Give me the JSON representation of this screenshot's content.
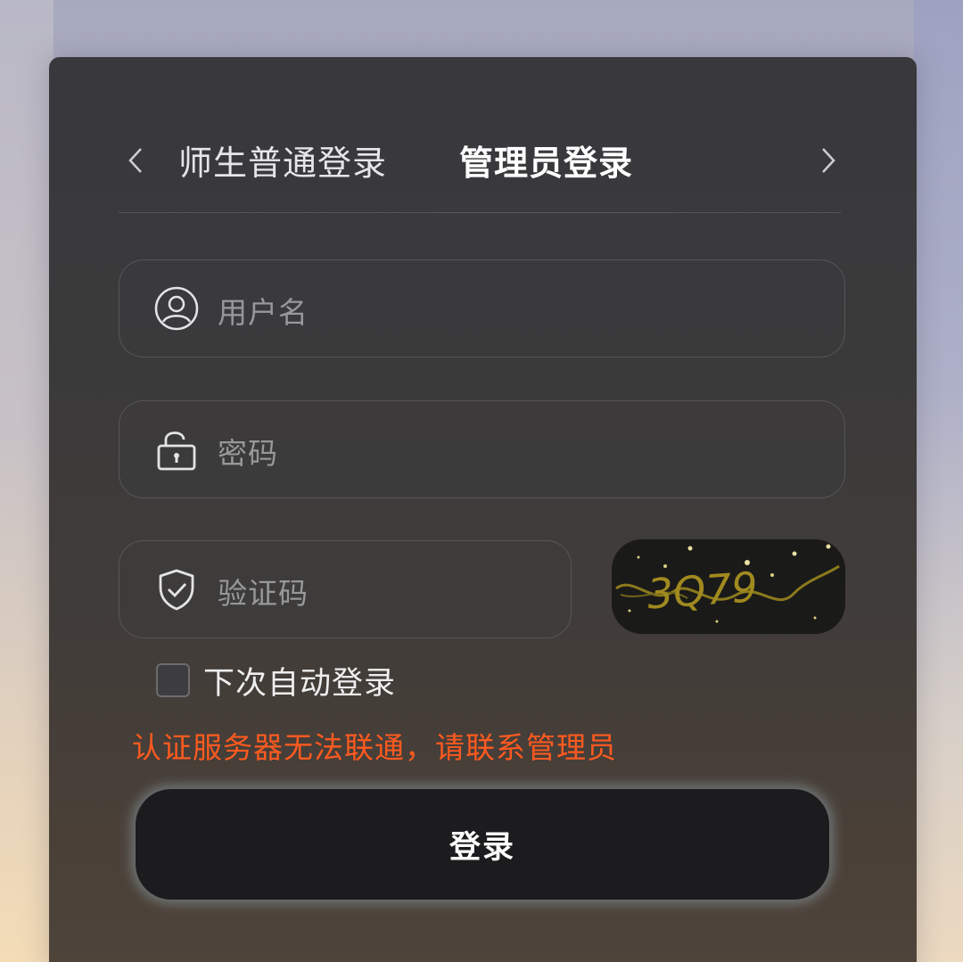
{
  "tabs": {
    "prev_icon": "chevron-left-icon",
    "next_icon": "chevron-right-icon",
    "items": [
      {
        "label": "师生普通登录",
        "active": false
      },
      {
        "label": "管理员登录",
        "active": true
      }
    ]
  },
  "form": {
    "username": {
      "placeholder": "用户名",
      "value": "",
      "icon": "user-icon"
    },
    "password": {
      "placeholder": "密码",
      "value": "",
      "icon": "lock-icon"
    },
    "captcha": {
      "placeholder": "验证码",
      "value": "",
      "icon": "shield-check-icon",
      "image_text": "3Q79"
    },
    "remember": {
      "label": "下次自动登录",
      "checked": false
    },
    "error_message": "认证服务器无法联通，请联系管理员",
    "submit_label": "登录"
  },
  "colors": {
    "panel": "#3a3a3c",
    "error": "#ff5a1f",
    "button": "#1c1c1e",
    "button_glow": "#9aaab4"
  }
}
